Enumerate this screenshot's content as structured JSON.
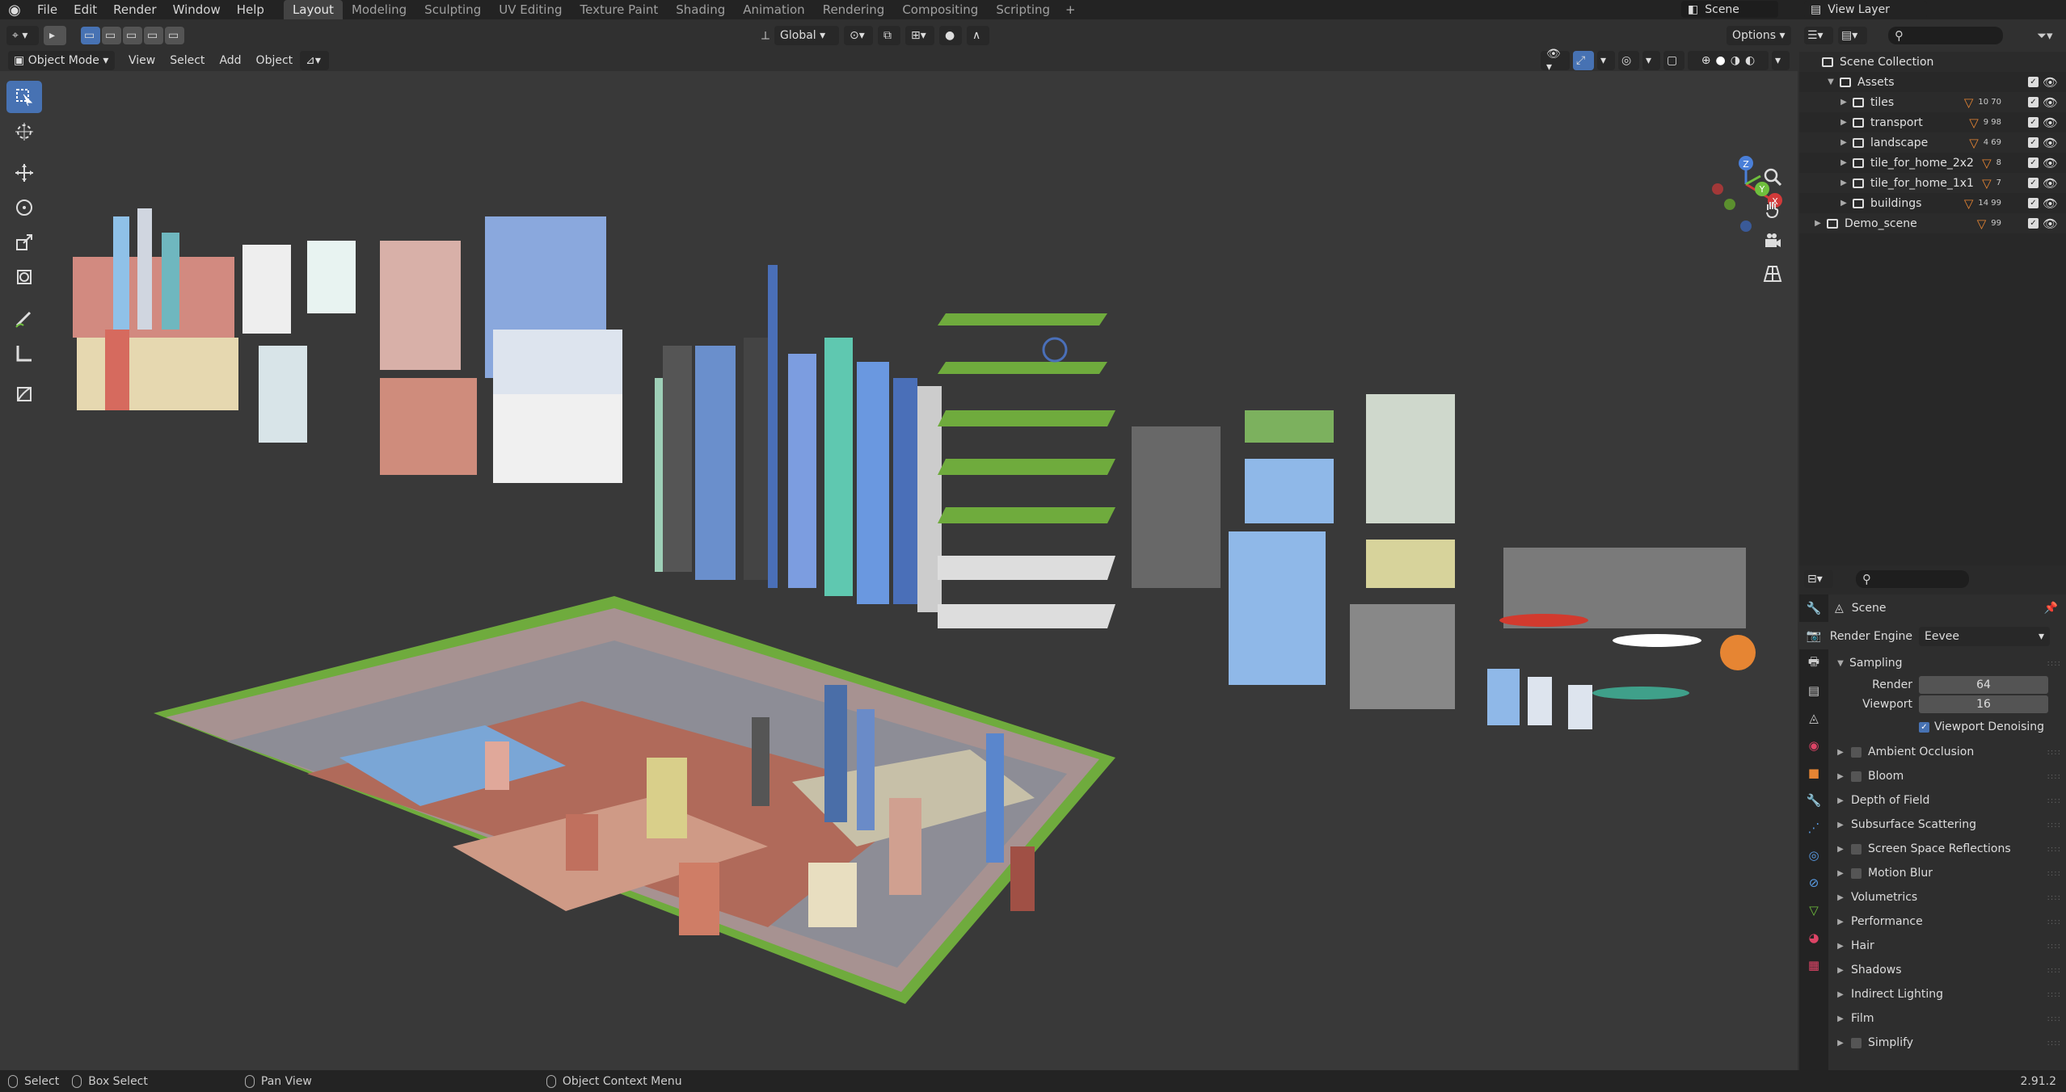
{
  "topbar": {
    "menus": [
      "File",
      "Edit",
      "Render",
      "Window",
      "Help"
    ],
    "workspaces": [
      "Layout",
      "Modeling",
      "Sculpting",
      "UV Editing",
      "Texture Paint",
      "Shading",
      "Animation",
      "Rendering",
      "Compositing",
      "Scripting"
    ],
    "active_workspace": "Layout",
    "scene": "Scene",
    "view_layer": "View Layer"
  },
  "viewport_header": {
    "mode": "Object Mode",
    "menus": [
      "View",
      "Select",
      "Add",
      "Object"
    ],
    "orientation": "Global",
    "options": "Options"
  },
  "gizmo": {
    "x": "X",
    "y": "Y",
    "z": "Z"
  },
  "outliner": {
    "root": "Scene Collection",
    "items": [
      {
        "label": "Assets",
        "depth": 0,
        "counts": ""
      },
      {
        "label": "tiles",
        "depth": 1,
        "counts": "10 70"
      },
      {
        "label": "transport",
        "depth": 1,
        "counts": "9 98"
      },
      {
        "label": "landscape",
        "depth": 1,
        "counts": "4 69"
      },
      {
        "label": "tile_for_home_2x2",
        "depth": 1,
        "counts": "8"
      },
      {
        "label": "tile_for_home_1x1",
        "depth": 1,
        "counts": "7"
      },
      {
        "label": "buildings",
        "depth": 1,
        "counts": "14 99"
      },
      {
        "label": "Demo_scene",
        "depth": 0,
        "counts": "99"
      }
    ]
  },
  "properties": {
    "title": "Scene",
    "render_engine_label": "Render Engine",
    "render_engine": "Eevee",
    "sampling": "Sampling",
    "render_label": "Render",
    "render_value": "64",
    "viewport_label": "Viewport",
    "viewport_value": "16",
    "viewport_denoising": "Viewport Denoising",
    "sections": [
      {
        "label": "Ambient Occlusion",
        "checkbox": true
      },
      {
        "label": "Bloom",
        "checkbox": true
      },
      {
        "label": "Depth of Field",
        "checkbox": false
      },
      {
        "label": "Subsurface Scattering",
        "checkbox": false
      },
      {
        "label": "Screen Space Reflections",
        "checkbox": true
      },
      {
        "label": "Motion Blur",
        "checkbox": true
      },
      {
        "label": "Volumetrics",
        "checkbox": false
      },
      {
        "label": "Performance",
        "checkbox": false
      },
      {
        "label": "Hair",
        "checkbox": false
      },
      {
        "label": "Shadows",
        "checkbox": false
      },
      {
        "label": "Indirect Lighting",
        "checkbox": false
      },
      {
        "label": "Film",
        "checkbox": false
      },
      {
        "label": "Simplify",
        "checkbox": true
      }
    ]
  },
  "statusbar": {
    "select": "Select",
    "box_select": "Box Select",
    "pan_view": "Pan View",
    "context_menu": "Object Context Menu",
    "version": "2.91.2"
  },
  "colors": {
    "accent": "#4772b3",
    "orange": "#e68533",
    "bg": "#393939"
  }
}
